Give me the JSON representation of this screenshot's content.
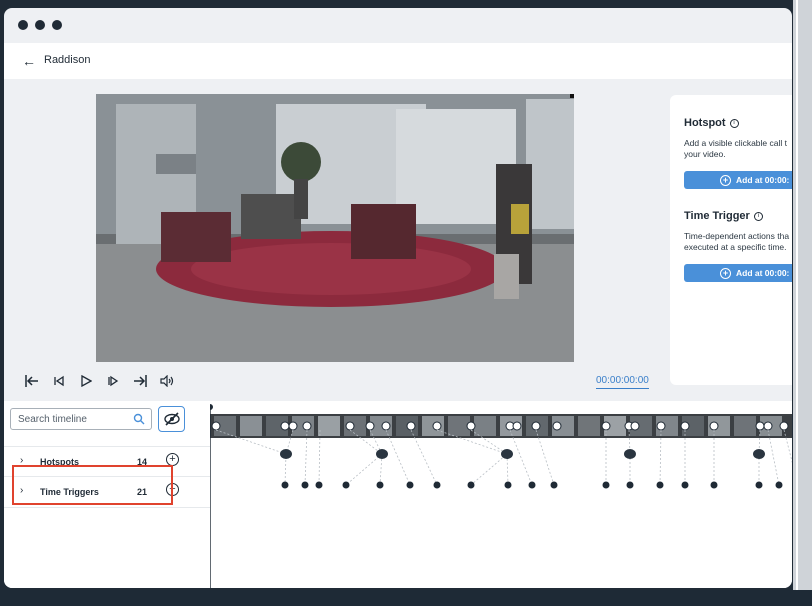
{
  "window": {
    "title": "Raddison"
  },
  "header": {
    "back_icon": "arrow-left-icon",
    "title": "Raddison"
  },
  "panel": {
    "hotspot_title": "Hotspot",
    "hotspot_desc_line1": "Add a visible clickable call t",
    "hotspot_desc_line2": "your video.",
    "hotspot_button": "Add at 00:00:",
    "trigger_title": "Time Trigger",
    "trigger_desc_line1": "Time-dependent actions tha",
    "trigger_desc_line2": "executed at a specific time.",
    "trigger_button": "Add at 00:00:"
  },
  "controls": {
    "icons": [
      "skip-to-start-icon",
      "step-back-icon",
      "play-icon",
      "step-forward-icon",
      "skip-to-end-icon",
      "volume-icon"
    ],
    "time": "00:00:00:00"
  },
  "timeline": {
    "search_placeholder": "Search timeline",
    "rows": [
      {
        "label": "Hotspots",
        "count": "14"
      },
      {
        "label": "Time Triggers",
        "count": "21"
      }
    ]
  },
  "colors": {
    "accent": "#4a90d9",
    "highlight": "#e0432e",
    "text": "#1f2a35"
  }
}
